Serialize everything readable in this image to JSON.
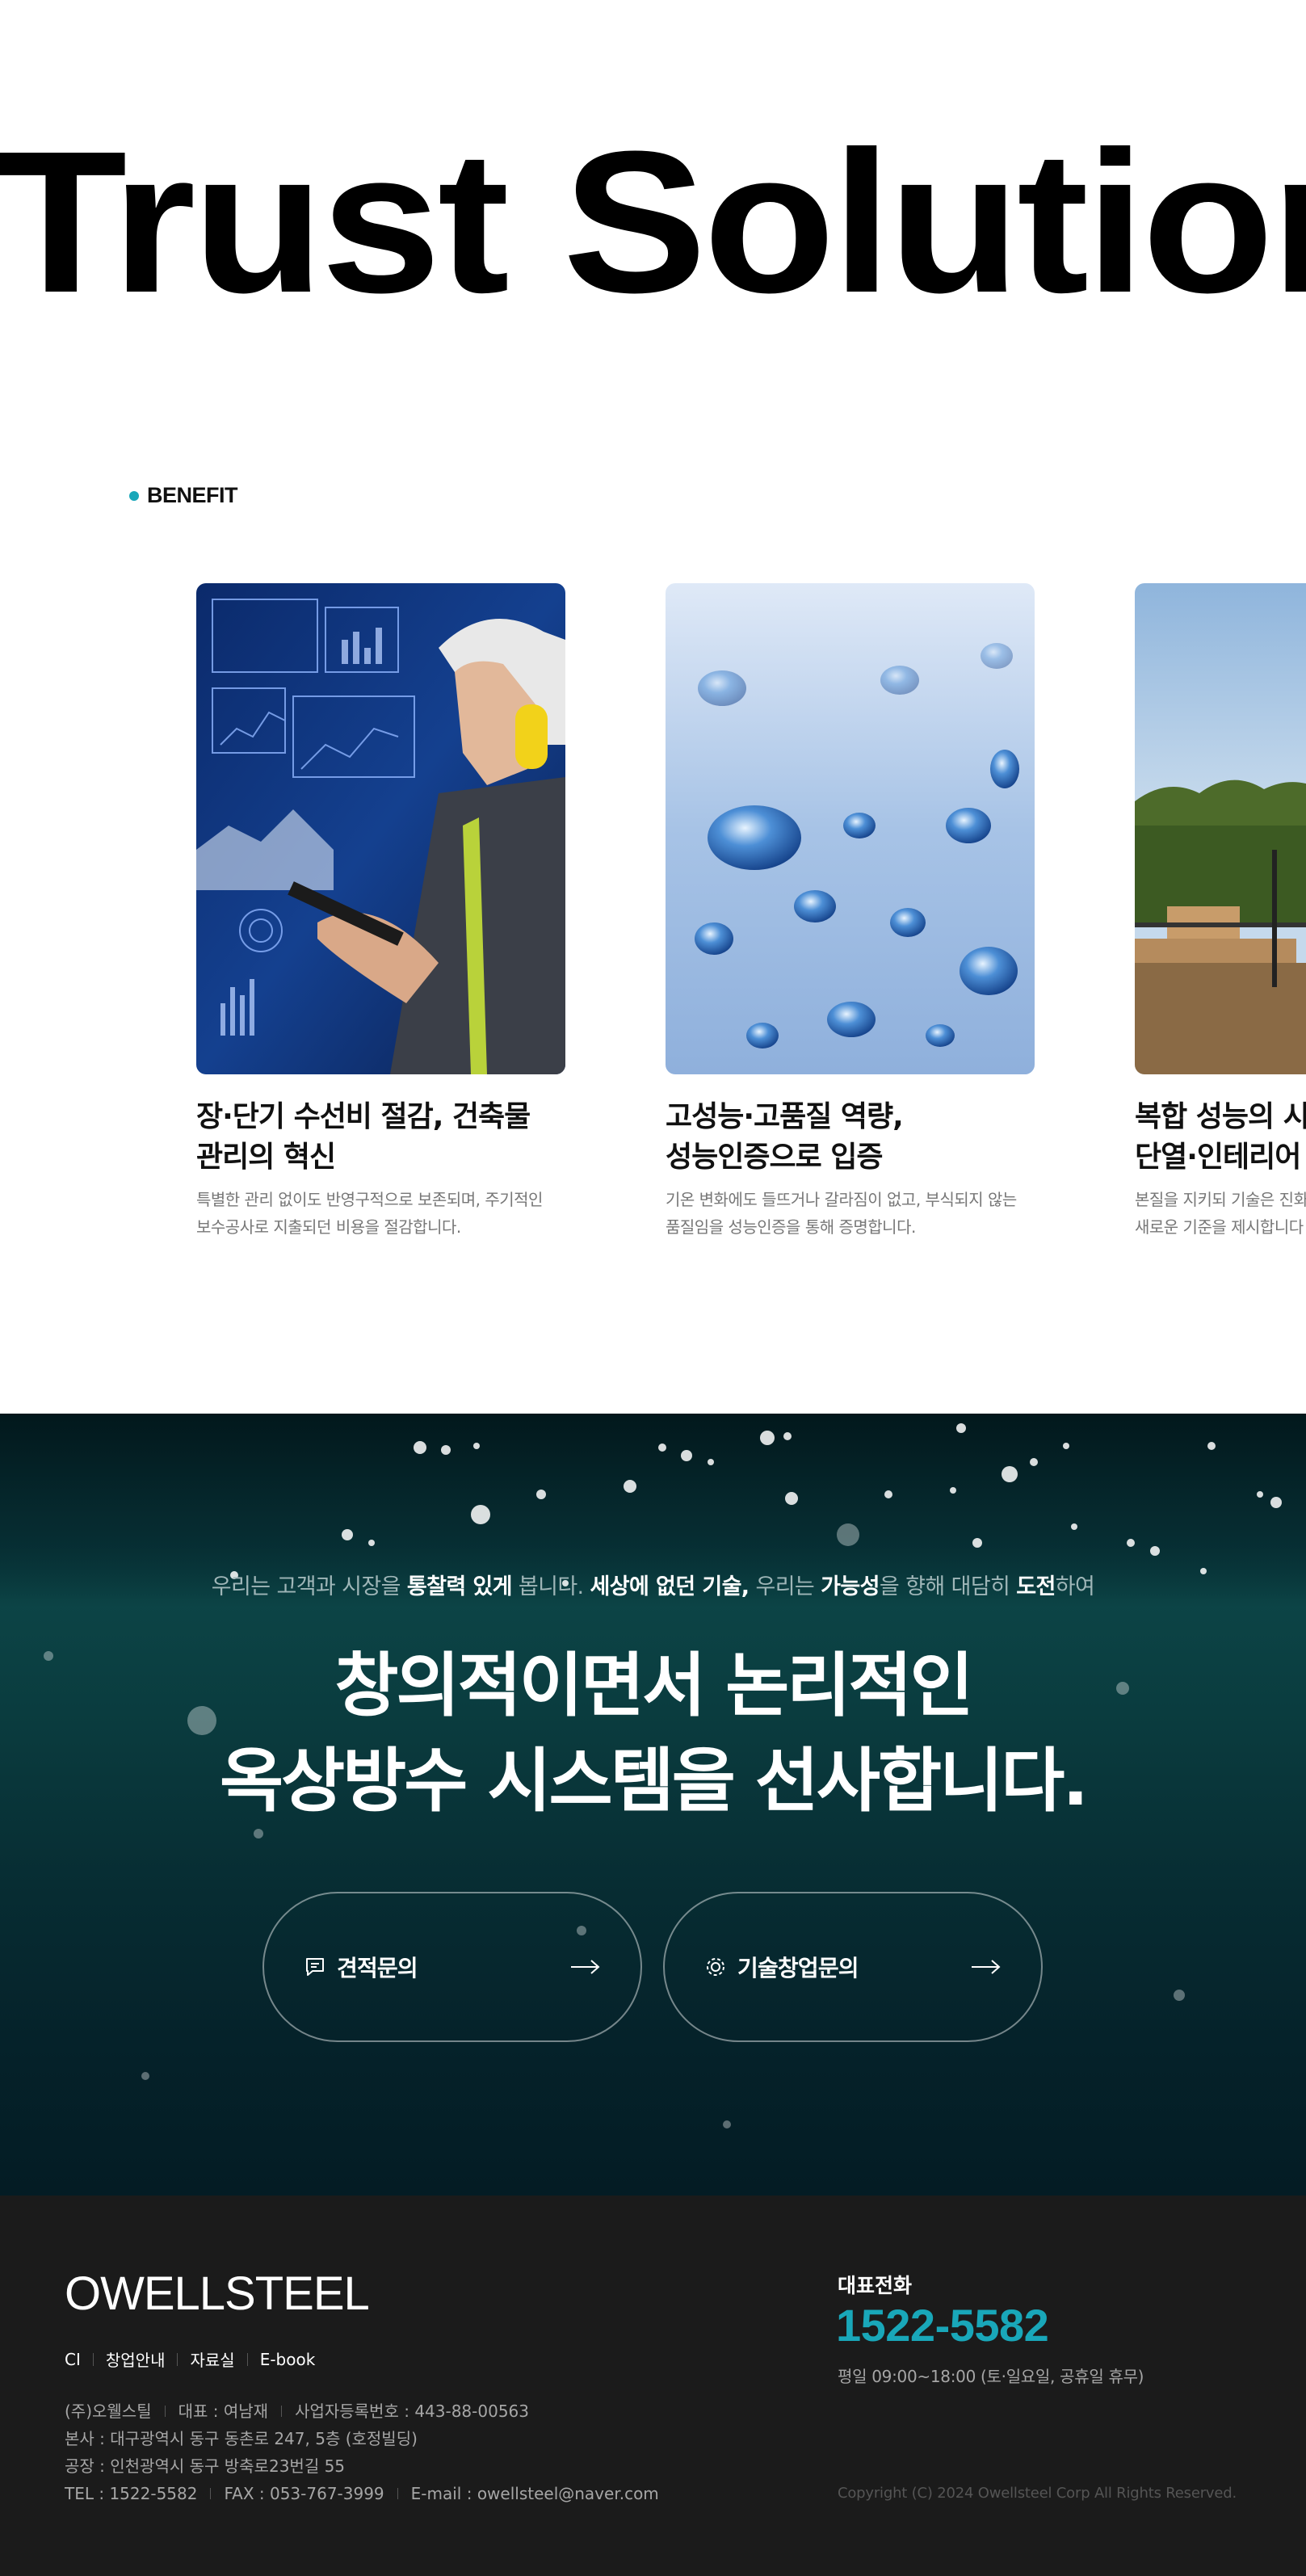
{
  "hero": {
    "title": "Trust Solution"
  },
  "benefit": {
    "label": "BENEFIT",
    "cards": [
      {
        "title": "장·단기 수선비 절감, 건축물\n관리의 혁신",
        "desc": "특별한 관리 없이도 반영구적으로 보존되며, 주기적인\n보수공사로 지출되던 비용을 절감합니다."
      },
      {
        "title": "고성능·고품질 역량,\n성능인증으로 입증",
        "desc": "기온 변화에도 들뜨거나 갈라짐이 없고, 부식되지 않는\n품질임을 성능인증을 통해 증명합니다."
      },
      {
        "title": "복합 성능의 시\n단열·인테리어",
        "desc": "본질을 지키되 기술은 진화\n새로운 기준을 제시합니다"
      }
    ]
  },
  "cta": {
    "sub_parts": [
      "우리는 고객과 시장을 ",
      "통찰력 있게",
      " 봅니다. ",
      "세상에 없던 기술,",
      " 우리는 ",
      "가능성",
      "을 향해 대담히 ",
      "도전",
      "하여"
    ],
    "headline": "창의적이면서 논리적인\n옥상방수 시스템을 선사합니다.",
    "buttons": [
      {
        "label": "견적문의",
        "icon": "chat-icon"
      },
      {
        "label": "기술창업문의",
        "icon": "gear-icon"
      }
    ]
  },
  "footer": {
    "logo": "OWELLSTEEL",
    "nav": [
      "CI",
      "창업안내",
      "자료실",
      "E-book"
    ],
    "info": {
      "company": "(주)오웰스틸",
      "ceo": "대표 : 여남재",
      "biz_no": "사업자등록번호 : 443-88-00563",
      "hq": "본사 : 대구광역시 동구 동촌로 247, 5층 (호정빌딩)",
      "factory": "공장 : 인천광역시 동구 방축로23번길 55",
      "tel": "TEL : 1522-5582",
      "fax": "FAX : 053-767-3999",
      "email": "E-mail : owellsteel@naver.com"
    },
    "rep_label": "대표전화",
    "rep_phone": "1522-5582",
    "rep_hours": "평일 09:00~18:00 (토·일요일, 공휴일 휴무)",
    "copyright": "Copyright (C) 2024 Owellsteel Corp All Rights Reserved."
  },
  "colors": {
    "accent": "#19a7b9",
    "footer_bg": "#1b1b1b",
    "cta_bg": "#07353a"
  }
}
